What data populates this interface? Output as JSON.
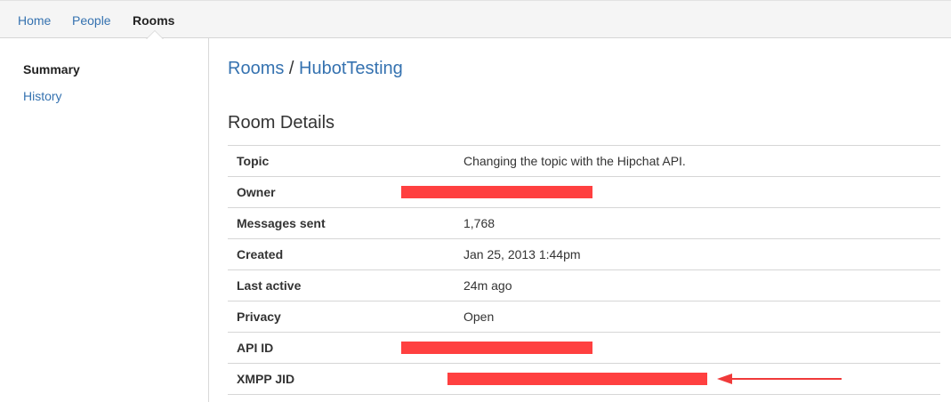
{
  "nav": {
    "items": [
      {
        "label": "Home"
      },
      {
        "label": "People"
      },
      {
        "label": "Rooms"
      }
    ],
    "active": "Rooms"
  },
  "sidebar": {
    "items": [
      {
        "label": "Summary"
      },
      {
        "label": "History"
      }
    ]
  },
  "breadcrumb": {
    "parent": "Rooms",
    "separator": "/",
    "current": "HubotTesting"
  },
  "section": {
    "title": "Room Details"
  },
  "details": [
    {
      "label": "Topic",
      "value": "Changing the topic with the Hipchat API."
    },
    {
      "label": "Owner",
      "value": ""
    },
    {
      "label": "Messages sent",
      "value": "1,768"
    },
    {
      "label": "Created",
      "value": "Jan 25, 2013 1:44pm"
    },
    {
      "label": "Last active",
      "value": "24m ago"
    },
    {
      "label": "Privacy",
      "value": "Open"
    },
    {
      "label": "API ID",
      "value": ""
    },
    {
      "label": "XMPP JID",
      "value": ""
    }
  ],
  "colors": {
    "link": "#3572b0",
    "redaction": "#ff4040",
    "annotation_arrow": "#f03a3a"
  }
}
